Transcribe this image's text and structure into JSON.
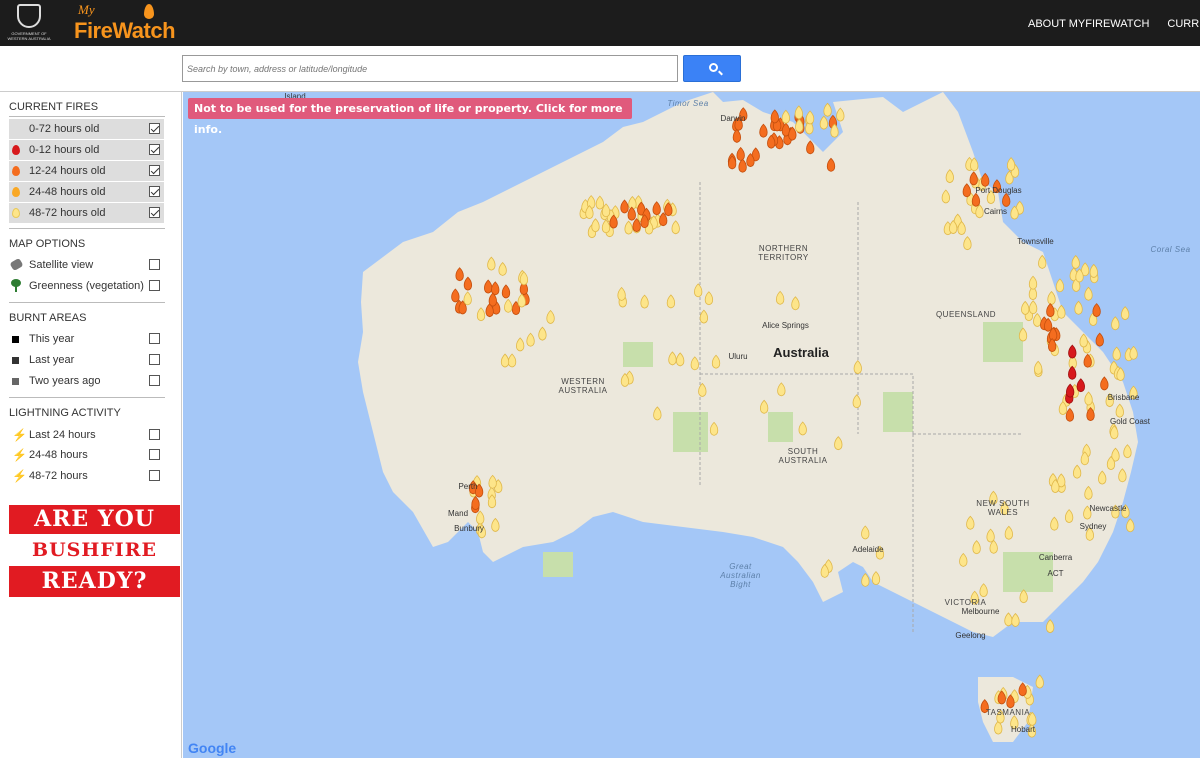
{
  "header": {
    "gov_label": "GOVERNMENT OF WESTERN AUSTRALIA",
    "logo_my": "My",
    "logo_name": "FireWatch",
    "nav": [
      "ABOUT MYFIREWATCH",
      "CURRENT..."
    ]
  },
  "search": {
    "placeholder": "Search by town, address or latitude/longitude",
    "button_icon": "search-icon"
  },
  "sidebar": {
    "current_fires": {
      "heading": "CURRENT FIRES",
      "items": [
        {
          "label": "0-72 hours old",
          "checked": true,
          "icon": "",
          "color": ""
        },
        {
          "label": "0-12 hours old",
          "checked": true,
          "icon": "fire-icon",
          "color": "#d7191c"
        },
        {
          "label": "12-24 hours old",
          "checked": true,
          "icon": "fire-icon",
          "color": "#f46d1f"
        },
        {
          "label": "24-48 hours old",
          "checked": true,
          "icon": "fire-icon",
          "color": "#f9a825"
        },
        {
          "label": "48-72 hours old",
          "checked": true,
          "icon": "fire-icon",
          "color": "#fde58a"
        }
      ]
    },
    "map_options": {
      "heading": "MAP OPTIONS",
      "items": [
        {
          "label": "Satellite view",
          "checked": false,
          "icon": "satellite-icon"
        },
        {
          "label": "Greenness (vegetation)",
          "checked": false,
          "icon": "tree-icon"
        }
      ]
    },
    "burnt_areas": {
      "heading": "BURNT AREAS",
      "items": [
        {
          "label": "This year",
          "checked": false,
          "color": "#000000"
        },
        {
          "label": "Last year",
          "checked": false,
          "color": "#333333"
        },
        {
          "label": "Two years ago",
          "checked": false,
          "color": "#666666"
        }
      ]
    },
    "lightning": {
      "heading": "LIGHTNING ACTIVITY",
      "items": [
        {
          "label": "Last 24 hours",
          "checked": false,
          "color": "#d7191c"
        },
        {
          "label": "24-48 hours",
          "checked": false,
          "color": "#f46d1f"
        },
        {
          "label": "48-72 hours",
          "checked": false,
          "color": "#f9a825"
        }
      ]
    },
    "banner": [
      "ARE YOU",
      "BUSHFIRE",
      "READY?"
    ]
  },
  "map": {
    "warning": "Not to be used for the preservation of life or property. Click for more info.",
    "labels": {
      "timor_sea": "Timor Sea",
      "coral_sea": "Coral Sea",
      "great_australian_bight": "Great Australian Bight",
      "australia": "Australia",
      "northern_territory": "NORTHERN TERRITORY",
      "western_australia": "WESTERN AUSTRALIA",
      "queensland": "QUEENSLAND",
      "south_australia": "SOUTH AUSTRALIA",
      "new_south_wales": "NEW SOUTH WALES",
      "victoria": "VICTORIA",
      "tasmania": "TASMANIA",
      "darwin": "Darwin",
      "alice_springs": "Alice Springs",
      "uluru": "Uluru",
      "perth": "Perth",
      "mandurah": "Mand",
      "bunbury": "Bunbury",
      "adelaide": "Adelaide",
      "melbourne": "Melbourne",
      "geelong": "Geelong",
      "canberra": "Canberra",
      "act": "ACT",
      "sydney": "Sydney",
      "newcastle": "Newcastle",
      "brisbane": "Brisbane",
      "gold_coast": "Gold Coast",
      "townsville": "Townsville",
      "port_douglas": "Port Douglas",
      "cairns": "Cairns",
      "hobart": "Hobart",
      "island": "Island"
    },
    "attribution": "Google"
  },
  "fires": [
    [
      555,
      10,
      "r"
    ],
    [
      540,
      15,
      "o"
    ],
    [
      560,
      25,
      "y"
    ],
    [
      588,
      22,
      "y"
    ],
    [
      570,
      35,
      "o"
    ],
    [
      600,
      40,
      "y"
    ],
    [
      615,
      45,
      "y"
    ],
    [
      630,
      25,
      "o"
    ],
    [
      645,
      20,
      "y"
    ],
    [
      660,
      55,
      "y"
    ],
    [
      590,
      60,
      "y"
    ],
    [
      575,
      70,
      "y"
    ],
    [
      545,
      80,
      "y"
    ],
    [
      530,
      90,
      "o"
    ],
    [
      500,
      95,
      "y"
    ],
    [
      470,
      110,
      "y"
    ],
    [
      445,
      100,
      "y"
    ],
    [
      460,
      120,
      "o"
    ],
    [
      420,
      125,
      "y"
    ],
    [
      430,
      140,
      "o"
    ],
    [
      455,
      145,
      "y"
    ],
    [
      480,
      155,
      "y"
    ],
    [
      495,
      150,
      "y"
    ],
    [
      510,
      170,
      "y"
    ],
    [
      525,
      180,
      "y"
    ],
    [
      540,
      200,
      "y"
    ],
    [
      550,
      215,
      "y"
    ],
    [
      565,
      230,
      "y"
    ],
    [
      580,
      245,
      "y"
    ],
    [
      600,
      250,
      "y"
    ],
    [
      620,
      240,
      "y"
    ],
    [
      640,
      260,
      "y"
    ],
    [
      665,
      270,
      "y"
    ],
    [
      690,
      260,
      "y"
    ],
    [
      705,
      285,
      "y"
    ],
    [
      720,
      300,
      "y"
    ],
    [
      745,
      310,
      "y"
    ],
    [
      760,
      280,
      "y"
    ],
    [
      790,
      230,
      "y"
    ],
    [
      805,
      245,
      "y"
    ],
    [
      815,
      260,
      "y"
    ],
    [
      830,
      275,
      "y"
    ],
    [
      845,
      285,
      "y"
    ],
    [
      860,
      260,
      "y"
    ],
    [
      880,
      280,
      "y"
    ],
    [
      900,
      300,
      "y"
    ],
    [
      930,
      290,
      "y"
    ],
    [
      960,
      310,
      "y"
    ],
    [
      1000,
      280,
      "y"
    ],
    [
      1010,
      300,
      "y"
    ],
    [
      1030,
      320,
      "o"
    ],
    [
      1050,
      330,
      "y"
    ],
    [
      1060,
      350,
      "y"
    ],
    [
      1080,
      365,
      "y"
    ],
    [
      1100,
      385,
      "y"
    ],
    [
      1090,
      410,
      "y"
    ],
    [
      1070,
      430,
      "y"
    ],
    [
      1050,
      440,
      "y"
    ],
    [
      1030,
      450,
      "y"
    ],
    [
      1000,
      470,
      "y"
    ],
    [
      980,
      490,
      "y"
    ],
    [
      960,
      500,
      "y"
    ],
    [
      940,
      520,
      "y"
    ],
    [
      920,
      535,
      "y"
    ],
    [
      900,
      550,
      "o"
    ],
    [
      880,
      560,
      "y"
    ],
    [
      860,
      570,
      "y"
    ],
    [
      840,
      590,
      "y"
    ],
    [
      820,
      605,
      "y"
    ],
    [
      800,
      615,
      "o"
    ],
    [
      780,
      620,
      "y"
    ],
    [
      760,
      630,
      "y"
    ],
    [
      740,
      640,
      "y"
    ],
    [
      720,
      650,
      "y"
    ],
    [
      700,
      660,
      "y"
    ],
    [
      680,
      665,
      "y"
    ],
    [
      660,
      660,
      "y"
    ],
    [
      640,
      650,
      "y"
    ],
    [
      620,
      640,
      "o"
    ],
    [
      600,
      630,
      "y"
    ],
    [
      580,
      620,
      "y"
    ],
    [
      560,
      610,
      "y"
    ],
    [
      540,
      600,
      "y"
    ],
    [
      520,
      590,
      "y"
    ],
    [
      500,
      580,
      "y"
    ],
    [
      480,
      575,
      "y"
    ],
    [
      460,
      570,
      "y"
    ],
    [
      440,
      560,
      "o"
    ],
    [
      420,
      550,
      "y"
    ],
    [
      400,
      540,
      "y"
    ],
    [
      380,
      530,
      "y"
    ],
    [
      360,
      520,
      "y"
    ],
    [
      340,
      510,
      "y"
    ],
    [
      320,
      500,
      "y"
    ],
    [
      300,
      490,
      "y"
    ],
    [
      280,
      480,
      "o"
    ],
    [
      270,
      470,
      "y"
    ],
    [
      260,
      460,
      "y"
    ],
    [
      250,
      450,
      "y"
    ],
    [
      240,
      440,
      "y"
    ],
    [
      230,
      430,
      "y"
    ],
    [
      220,
      420,
      "y"
    ],
    [
      210,
      410,
      "y"
    ],
    [
      200,
      400,
      "o"
    ],
    [
      195,
      390,
      "y"
    ],
    [
      190,
      380,
      "y"
    ],
    [
      185,
      370,
      "y"
    ],
    [
      180,
      360,
      "y"
    ],
    [
      175,
      350,
      "y"
    ],
    [
      170,
      340,
      "y"
    ],
    [
      160,
      330,
      "y"
    ],
    [
      150,
      320,
      "y"
    ],
    [
      140,
      310,
      "y"
    ],
    [
      130,
      300,
      "y"
    ],
    [
      120,
      290,
      "o"
    ],
    [
      110,
      280,
      "y"
    ],
    [
      100,
      270,
      "y"
    ],
    [
      90,
      260,
      "y"
    ],
    [
      80,
      250,
      "y"
    ],
    [
      70,
      240,
      "y"
    ],
    [
      60,
      230,
      "y"
    ],
    [
      50,
      220,
      "y"
    ],
    [
      40,
      210,
      "y"
    ],
    [
      30,
      200,
      "y"
    ],
    [
      20,
      190,
      "y"
    ],
    [
      10,
      180,
      "y"
    ],
    [
      0,
      170,
      "y"
    ]
  ]
}
